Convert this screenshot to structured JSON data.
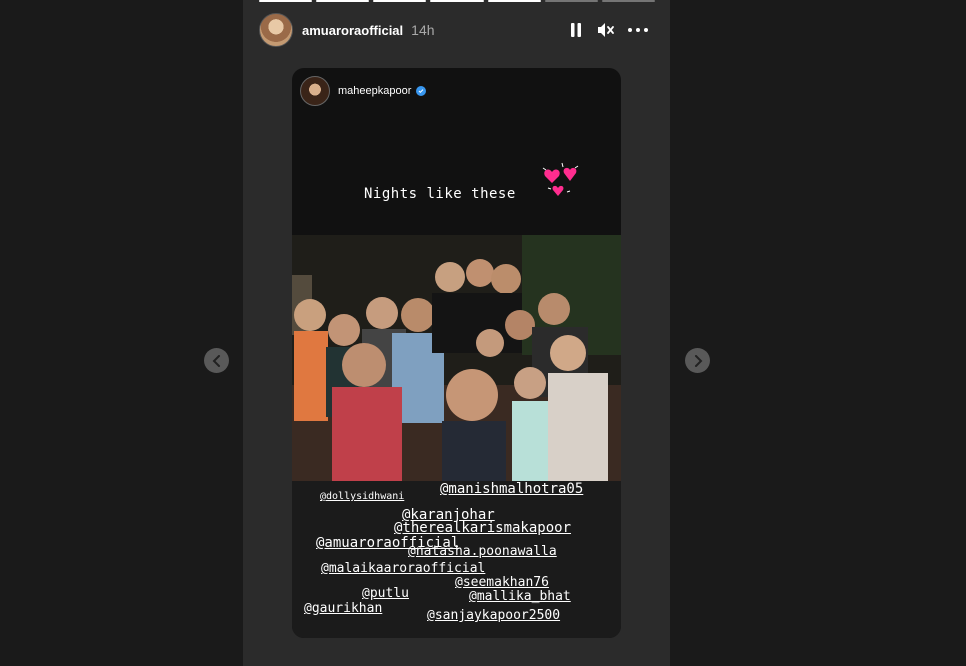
{
  "story": {
    "segments": [
      true,
      true,
      true,
      true,
      true,
      false,
      false
    ],
    "username": "amuaroraofficial",
    "time_ago": "14h"
  },
  "reshare": {
    "username": "maheepkapoor",
    "caption": "Nights like these"
  },
  "tags": [
    "@dollysidhwani",
    "@manishmalhotra05",
    "@karanjohar",
    "@therealkarismakapoor",
    "@amuaroraofficial",
    "@natasha.poonawalla",
    "@malaikaaroraofficial",
    "@seemakhan76",
    "@putlu",
    "@mallika_bhat",
    "@gaurikhan",
    "@sanjaykapoor2500"
  ],
  "icons": {
    "pause": "pause-icon",
    "mute": "mute-icon",
    "more": "more-icon",
    "prev": "chevron-left-icon",
    "next": "chevron-right-icon",
    "verified": "verified-badge-icon"
  },
  "colors": {
    "background": "#1a1a1a",
    "card": "#2b2b2b",
    "verified": "#3897f0",
    "hearts": "#ff2d8f"
  }
}
